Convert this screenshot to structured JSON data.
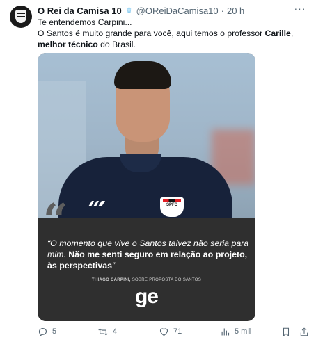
{
  "tweet": {
    "display_name": "O Rei da Camisa 10",
    "handle": "@OReiDaCamisa10",
    "separator": "·",
    "time": "20 h",
    "text_line1": "Te entendemos Carpini...",
    "text_line2_prefix": "O Santos é muito grande para você, aqui temos o professor ",
    "text_line2_bold1": "Carille",
    "text_line2_mid": ", ",
    "text_line2_bold2": "melhor técnico",
    "text_line2_suffix": " do Brasil."
  },
  "media": {
    "badge_text": "SPFC",
    "quote_normal": "“O momento que vive o Santos talvez não seria para mim. ",
    "quote_bold": "Não me senti seguro em relação ao projeto, às perspectivas",
    "quote_end": "”",
    "credit_name": "THIAGO CARPINI,",
    "credit_rest": " SOBRE PROPOSTA DO SANTOS",
    "logo": "ge"
  },
  "actions": {
    "replies": "5",
    "retweets": "4",
    "likes": "71",
    "views": "5 mil"
  },
  "colors": {
    "verified": "#8ecdf0",
    "secondary_text": "#536471",
    "quote_panel": "#2f2f2f"
  },
  "icons": [
    "verified-icon",
    "more-icon",
    "reply-icon",
    "retweet-icon",
    "like-icon",
    "views-icon",
    "bookmark-icon",
    "share-icon"
  ]
}
